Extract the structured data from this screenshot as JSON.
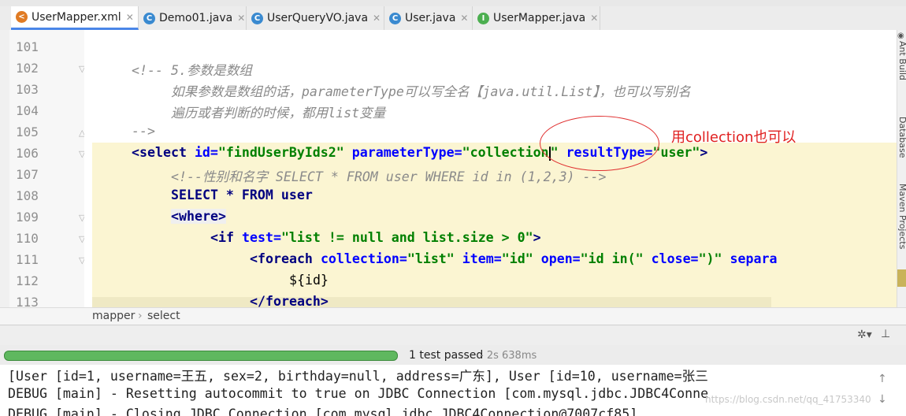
{
  "tabs": [
    {
      "label": "UserMapper.xml",
      "icon": "xml-file-icon",
      "active": true
    },
    {
      "label": "Demo01.java",
      "icon": "java-class-icon",
      "active": false
    },
    {
      "label": "UserQueryVO.java",
      "icon": "java-class-icon",
      "active": false
    },
    {
      "label": "User.java",
      "icon": "java-class-icon",
      "active": false
    },
    {
      "label": "UserMapper.java",
      "icon": "java-interface-icon",
      "active": false
    }
  ],
  "line_numbers": [
    "101",
    "102",
    "103",
    "104",
    "105",
    "106",
    "107",
    "108",
    "109",
    "110",
    "111",
    "112",
    "113"
  ],
  "code": {
    "l102": "<!-- 5.参数是数组",
    "l103": "如果参数是数组的话，parameterType可以写全名【java.util.List】，也可以写别名",
    "l104": "遍历或者判断的时候，都用list变量",
    "l105": "-->",
    "l106_a": "<select",
    "l106_b": "id=",
    "l106_c": "\"findUserByIds2\"",
    "l106_d": "parameterType=",
    "l106_e": "\"collection",
    "l106_f": "\"",
    "l106_g": "resultType=",
    "l106_h": "\"user\"",
    "l106_i": ">",
    "l107": "<!--性别和名字 SELECT * FROM user WHERE id in (1,2,3) -->",
    "l108": "SELECT * FROM user",
    "l109": "<where>",
    "l110_a": "<if",
    "l110_b": "test=",
    "l110_c": "\"list != null and list.size > 0\"",
    "l110_d": ">",
    "l111_a": "<foreach",
    "l111_b": "collection=",
    "l111_c": "\"list\"",
    "l111_d": "item=",
    "l111_e": "\"id\"",
    "l111_f": "open=",
    "l111_g": "\"id in(\"",
    "l111_h": "close=",
    "l111_i": "\")\"",
    "l111_j": "separa",
    "l112": "${id}",
    "l113": "</foreach>"
  },
  "annotation": "用collection也可以",
  "breadcrumb": [
    "mapper",
    "select"
  ],
  "right_tools": [
    "Ant Build",
    "Database",
    "Maven Projects"
  ],
  "test_status": {
    "passed": "1 test passed",
    "time": "- 2s 638ms",
    "progress": 1.0
  },
  "console": [
    "[User [id=1, username=王五, sex=2, birthday=null, address=广东], User [id=10, username=张三",
    "DEBUG [main] - Resetting autocommit to true on JDBC Connection [com.mysql.jdbc.JDBC4Conne",
    "DEBUG [main] - Closing JDBC Connection [com.mysql.jdbc.JDBC4Connection@7007cf85]"
  ],
  "watermark": "https://blog.csdn.net/qq_41753340",
  "colors": {
    "accent": "#4a86e8",
    "progress": "#5fb85f",
    "annotation": "#e02020"
  }
}
